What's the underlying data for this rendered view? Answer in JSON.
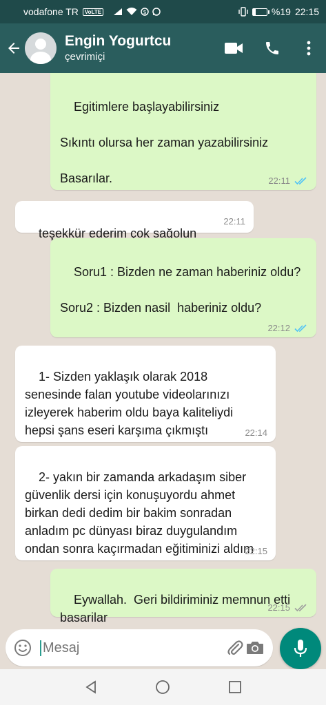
{
  "status_bar": {
    "carrier": "vodafone TR",
    "volte": "VoLTE",
    "battery": "%19",
    "time": "22:15",
    "battery_level": 0.19
  },
  "header": {
    "contact_name": "Engin Yogurtcu",
    "contact_status": "çevrimiçi"
  },
  "messages": [
    {
      "direction": "out",
      "text": "Egitimlere başlayabilirsiniz\n\nSıkıntı olursa her zaman yazabilirsiniz\n\nBasarılar.",
      "time": "22:11",
      "status": "read"
    },
    {
      "direction": "in",
      "text": "teşekkür ederim çok sağolun",
      "time": "22:11"
    },
    {
      "direction": "out",
      "text": "Soru1 : Bizden ne zaman haberiniz oldu?\n\nSoru2 : Bizden nasil  haberiniz oldu?",
      "time": "22:12",
      "status": "read"
    },
    {
      "direction": "in",
      "text": "1- Sizden yaklaşık olarak 2018 senesinde falan youtube videolarınızı izleyerek haberim oldu baya kaliteliydi hepsi şans eseri karşıma çıkmıştı",
      "time": "22:14"
    },
    {
      "direction": "in",
      "text": "2- yakın bir zamanda arkadaşım siber güvenlik dersi için konuşuyordu ahmet birkan dedi dedim bir bakim sonradan anladım pc dünyası biraz duygulandım ondan sonra kaçırmadan eğitiminizi aldım",
      "time": "22:15"
    },
    {
      "direction": "out",
      "text": "Eywallah.  Geri bildiriminiz memnun etti  basarilar",
      "time": "22:15",
      "status": "delivered"
    }
  ],
  "input": {
    "placeholder": "Mesaj"
  },
  "colors": {
    "header": "#2a5d5d",
    "status_bar": "#1f4a4a",
    "outgoing_bubble": "#dcf8c6",
    "incoming_bubble": "#ffffff",
    "mic_button": "#00897b",
    "read_tick": "#4fc3f7",
    "delivered_tick": "#9e9e9e"
  },
  "icons": [
    "back-arrow-icon",
    "avatar-icon",
    "video-call-icon",
    "phone-icon",
    "more-options-icon",
    "emoji-icon",
    "attach-icon",
    "camera-icon",
    "mic-icon",
    "nav-back-icon",
    "nav-home-icon",
    "nav-recents-icon"
  ]
}
